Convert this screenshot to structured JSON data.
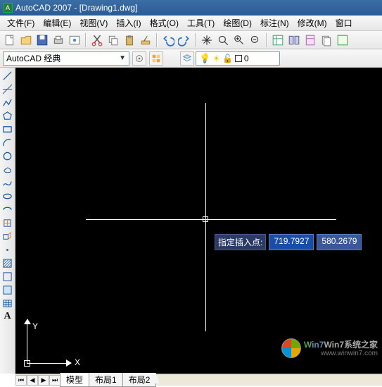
{
  "title": "AutoCAD 2007 - [Drawing1.dwg]",
  "menu": {
    "file": "文件(F)",
    "edit": "编辑(E)",
    "view": "视图(V)",
    "insert": "插入(I)",
    "format": "格式(O)",
    "tools": "工具(T)",
    "draw": "绘图(D)",
    "annotate": "标注(N)",
    "modify": "修改(M)",
    "window": "窗口"
  },
  "workspace": {
    "combo": "AutoCAD 经典"
  },
  "layer": {
    "current": "0"
  },
  "dyn": {
    "prompt": "指定插入点:",
    "x": "719.7927",
    "y": "580.2679"
  },
  "ucs": {
    "x": "X",
    "y": "Y"
  },
  "tabs": {
    "model": "模型",
    "layout1": "布局1",
    "layout2": "布局2"
  },
  "watermark": {
    "brand": "Win7系统之家",
    "url": "www.winwin7.com"
  }
}
